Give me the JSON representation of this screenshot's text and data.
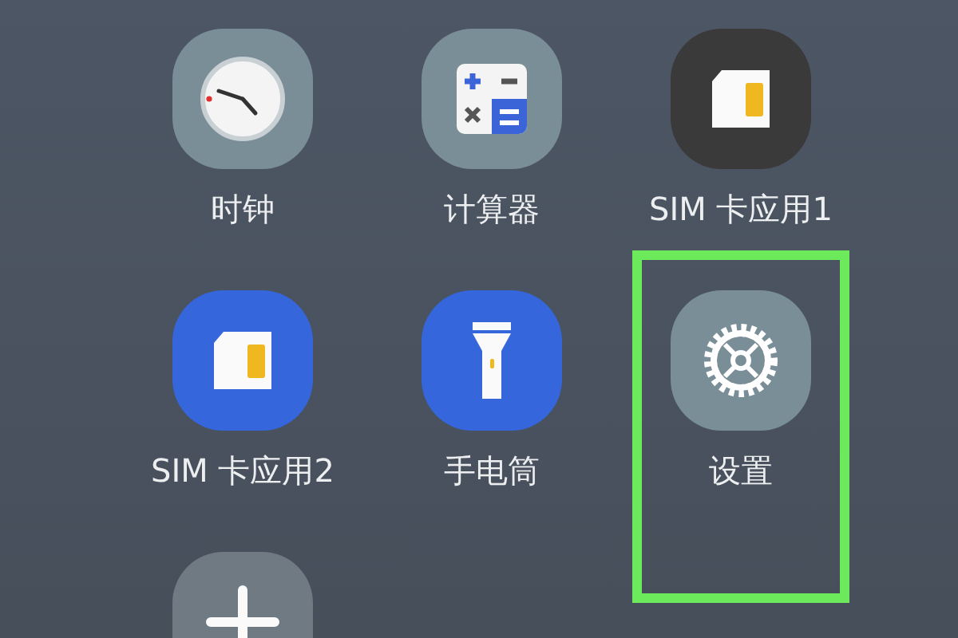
{
  "apps": [
    {
      "kind": "clock",
      "label": "时钟",
      "highlighted": false
    },
    {
      "kind": "calculator",
      "label": "计算器",
      "highlighted": false
    },
    {
      "kind": "sim-dark",
      "label": "SIM 卡应用1",
      "highlighted": false
    },
    {
      "kind": "sim-blue",
      "label": "SIM 卡应用2",
      "highlighted": false
    },
    {
      "kind": "flashlight",
      "label": "手电筒",
      "highlighted": false
    },
    {
      "kind": "settings",
      "label": "设置",
      "highlighted": true
    },
    {
      "kind": "add",
      "highlighted": false
    }
  ]
}
